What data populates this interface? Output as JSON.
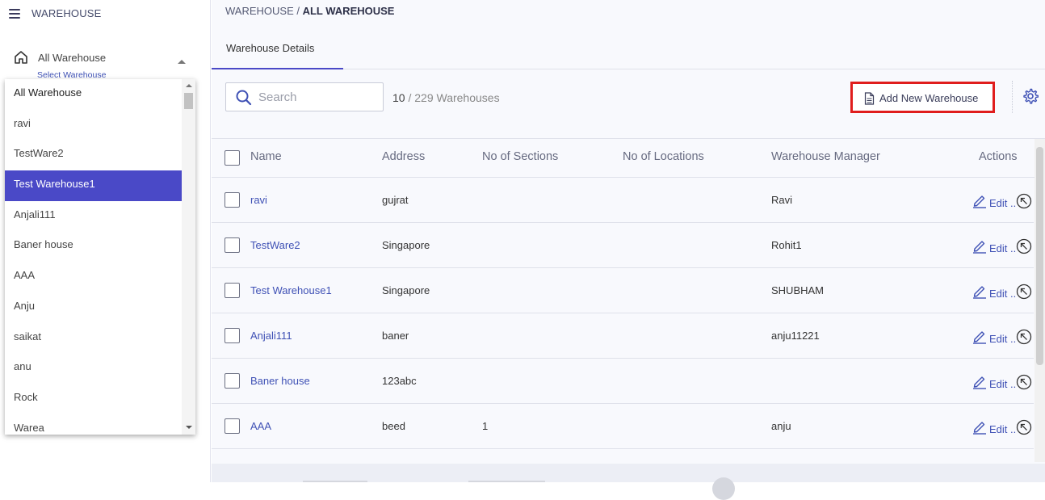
{
  "sidebar": {
    "title": "WAREHOUSE",
    "nav_label": "All Warehouse",
    "nav_sub": "Select Warehouse",
    "dropdown_options": [
      "All Warehouse",
      "ravi",
      "TestWare2",
      "Test Warehouse1",
      "Anjali111",
      "Baner house",
      "AAA",
      "Anju",
      "saikat",
      "anu",
      "Rock",
      "Warea"
    ],
    "selected_option": "Test Warehouse1"
  },
  "breadcrumb": {
    "root": "WAREHOUSE / ",
    "current": "ALL WAREHOUSE"
  },
  "tabs": [
    {
      "label": "Warehouse Details",
      "active": true
    }
  ],
  "toolbar": {
    "search_placeholder": "Search",
    "count_shown": "10",
    "count_total": " / 229 Warehouses",
    "add_button": "Add New Warehouse"
  },
  "table": {
    "columns": [
      "Name",
      "Address",
      "No of Sections",
      "No of Locations",
      "Warehouse Manager",
      "Actions"
    ],
    "edit_label": "Edit ..",
    "rows": [
      {
        "name": "ravi",
        "address": "gujrat",
        "sections": "",
        "locations": "",
        "manager": "Ravi"
      },
      {
        "name": "TestWare2",
        "address": "Singapore",
        "sections": "",
        "locations": "",
        "manager": "Rohit1"
      },
      {
        "name": "Test Warehouse1",
        "address": "Singapore",
        "sections": "",
        "locations": "",
        "manager": "SHUBHAM"
      },
      {
        "name": "Anjali111",
        "address": "baner",
        "sections": "",
        "locations": "",
        "manager": "anju11221"
      },
      {
        "name": "Baner house",
        "address": "123abc",
        "sections": "",
        "locations": "",
        "manager": ""
      },
      {
        "name": "AAA",
        "address": "beed",
        "sections": "1",
        "locations": "",
        "manager": "anju"
      }
    ]
  },
  "colors": {
    "accent": "#4a49c7",
    "link": "#3f51b5",
    "highlight": "#e01d1d"
  }
}
